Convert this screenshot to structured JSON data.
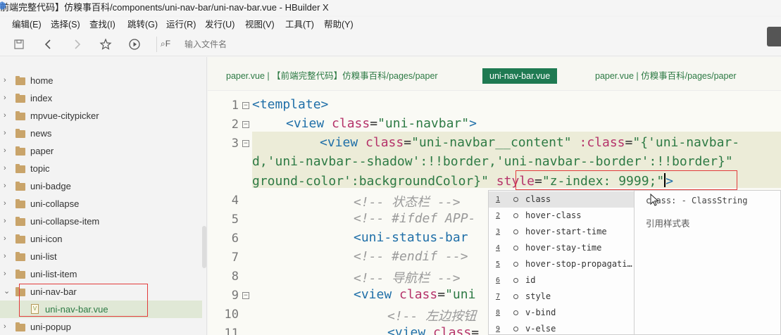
{
  "window": {
    "title": "前端完整代码】仿糗事百科/components/uni-nav-bar/uni-nav-bar.vue - HBuilder X"
  },
  "menu": [
    "编辑(E)",
    "选择(S)",
    "查找(I)",
    "跳转(G)",
    "运行(R)",
    "发行(U)",
    "视图(V)",
    "工具(T)",
    "帮助(Y)"
  ],
  "toolbar": {
    "search_label": "F",
    "search_placeholder": "输入文件名"
  },
  "sidebar": {
    "items": [
      {
        "label": "home",
        "type": "folder",
        "expanded": false
      },
      {
        "label": "index",
        "type": "folder",
        "expanded": false
      },
      {
        "label": "mpvue-citypicker",
        "type": "folder",
        "expanded": false
      },
      {
        "label": "news",
        "type": "folder",
        "expanded": false
      },
      {
        "label": "paper",
        "type": "folder",
        "expanded": false
      },
      {
        "label": "topic",
        "type": "folder",
        "expanded": false
      },
      {
        "label": "uni-badge",
        "type": "folder",
        "expanded": false
      },
      {
        "label": "uni-collapse",
        "type": "folder",
        "expanded": false
      },
      {
        "label": "uni-collapse-item",
        "type": "folder",
        "expanded": false
      },
      {
        "label": "uni-icon",
        "type": "folder",
        "expanded": false
      },
      {
        "label": "uni-list",
        "type": "folder",
        "expanded": false
      },
      {
        "label": "uni-list-item",
        "type": "folder",
        "expanded": false
      },
      {
        "label": "uni-nav-bar",
        "type": "folder",
        "expanded": true
      },
      {
        "label": "uni-nav-bar.vue",
        "type": "file",
        "selected": true
      },
      {
        "label": "uni-popup",
        "type": "folder",
        "expanded": false
      }
    ]
  },
  "tabs": [
    {
      "label": "paper.vue | 【前端完整代码】仿糗事百科/pages/paper",
      "active": false
    },
    {
      "label": "uni-nav-bar.vue",
      "active": true
    },
    {
      "label": "paper.vue | 仿糗事百科/pages/paper",
      "active": false
    }
  ],
  "code": {
    "line_numbers": [
      "1",
      "2",
      "3",
      "4",
      "5",
      "6",
      "7",
      "8",
      "9",
      "10",
      "11"
    ],
    "l1": "<template>",
    "l2_tag": "<view ",
    "l2_attr": "class",
    "l2_str": "\"uni-navbar\"",
    "l2_end": ">",
    "l3a_tag": "<view ",
    "l3a_attr": "class",
    "l3a_str": "\"uni-navbar__content\"",
    "l3a_attr2": ":class",
    "l3a_str2": "\"{'uni-navbar-",
    "l3b": "d,'uni-navbar--shadow':!!border,'uni-navbar--border':!!border}\"",
    "l3c_str": "ground-color':backgroundColor}\"",
    "l3c_attr": "style",
    "l3c_val": "\"z-index: 9999;\"",
    "l3c_end": ">",
    "l4": "<!-- 状态栏 -->",
    "l5": "<!-- #ifdef APP-",
    "l6": "<uni-status-bar",
    "l7": "<!-- #endif -->",
    "l8": "<!-- 导航栏 -->",
    "l9_tag": "<view ",
    "l9_attr": "class",
    "l9_str": "\"uni",
    "l10": "<!-- 左边按钮",
    "l11_tag": "<view ",
    "l11_attr": "class"
  },
  "autocomplete": {
    "items": [
      {
        "num": "1",
        "label": "class",
        "selected": true
      },
      {
        "num": "2",
        "label": "hover-class"
      },
      {
        "num": "3",
        "label": "hover-start-time"
      },
      {
        "num": "4",
        "label": "hover-stay-time"
      },
      {
        "num": "5",
        "label": "hover-stop-propagati…"
      },
      {
        "num": "6",
        "label": "id"
      },
      {
        "num": "7",
        "label": "style"
      },
      {
        "num": "8",
        "label": "v-bind"
      },
      {
        "num": "9",
        "label": "v-else"
      }
    ],
    "detail_signature": "class: - ClassString",
    "detail_doc": "引用样式表"
  }
}
